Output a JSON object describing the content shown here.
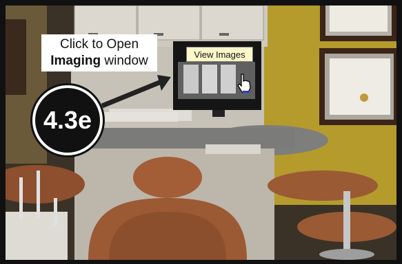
{
  "callout": {
    "line1": "Click to Open",
    "line2_bold": "Imaging",
    "line2_rest": " window"
  },
  "tooltip": {
    "text": "View Images"
  },
  "step_badge": {
    "text": "4.3e"
  },
  "colors": {
    "wall": "#b59b2c",
    "cabinet": "#d3cfc6",
    "chair": "#9b5a34",
    "countertop": "#7b7b7a",
    "badge": "#111111",
    "tooltip_bg": "#fdf7c9"
  },
  "icons": [
    "hand-pointer-icon",
    "arrow-icon"
  ]
}
